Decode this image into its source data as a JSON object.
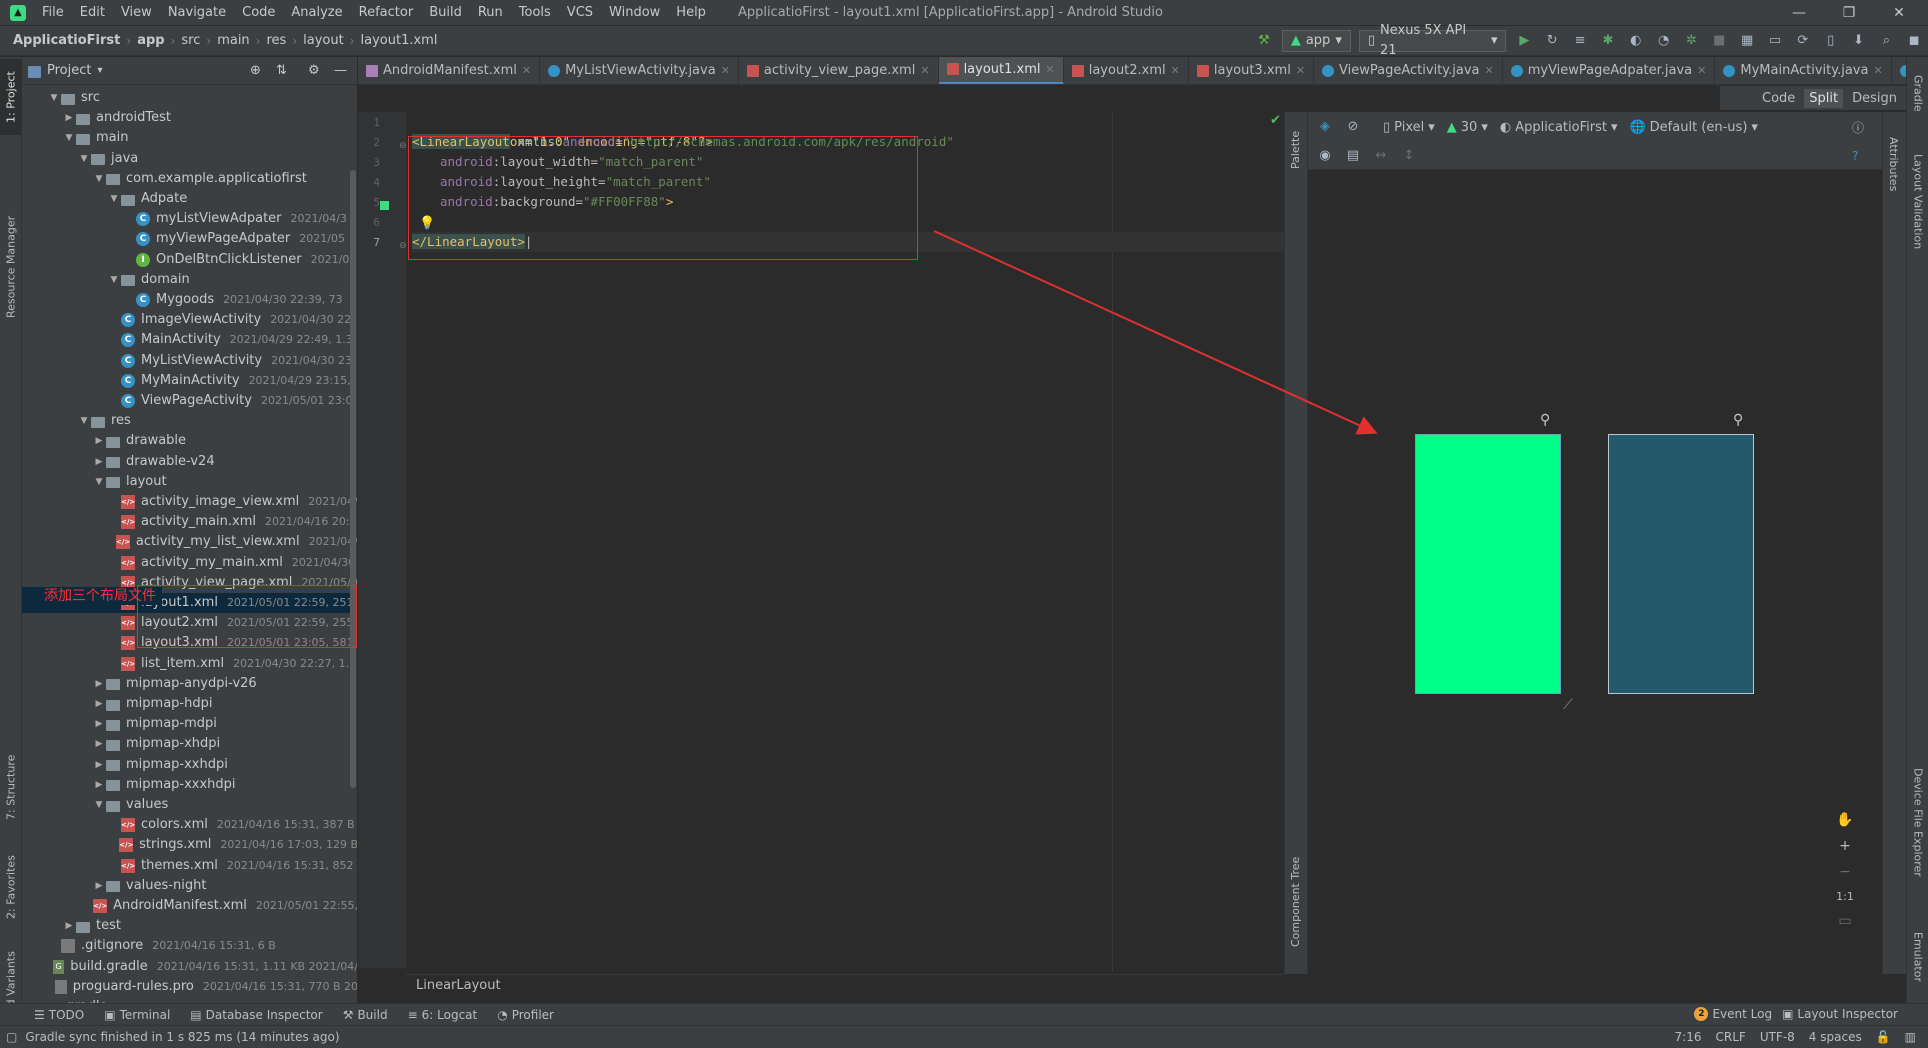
{
  "menubar": {
    "items": [
      "File",
      "Edit",
      "View",
      "Navigate",
      "Code",
      "Analyze",
      "Refactor",
      "Build",
      "Run",
      "Tools",
      "VCS",
      "Window",
      "Help"
    ],
    "window_title": "ApplicatioFirst - layout1.xml [ApplicatioFirst.app] - Android Studio"
  },
  "navbar": {
    "crumbs": [
      "ApplicatioFirst",
      "app",
      "src",
      "main",
      "res",
      "layout",
      "layout1.xml"
    ],
    "run_config": "app",
    "device": "Nexus 5X API 21"
  },
  "left_strip": {
    "tabs": [
      "1: Project",
      "Resource Manager",
      "7: Structure",
      "2: Favorites",
      "Build Variants"
    ]
  },
  "right_strip": {
    "tabs": [
      "Gradle",
      "Layout Validation",
      "Attributes",
      "Device File Explorer",
      "Emulator"
    ]
  },
  "project": {
    "header": "Project",
    "tree": [
      {
        "label": "src",
        "meta": "",
        "type": "folder",
        "indent": 1,
        "arrow": "down"
      },
      {
        "label": "androidTest",
        "meta": "",
        "type": "folder",
        "indent": 2,
        "arrow": "right"
      },
      {
        "label": "main",
        "meta": "",
        "type": "folder",
        "indent": 2,
        "arrow": "down"
      },
      {
        "label": "java",
        "meta": "",
        "type": "folder",
        "indent": 3,
        "arrow": "down"
      },
      {
        "label": "com.example.applicatiofirst",
        "meta": "",
        "type": "folder",
        "indent": 4,
        "arrow": "down"
      },
      {
        "label": "Adpate",
        "meta": "",
        "type": "folder",
        "indent": 5,
        "arrow": "down"
      },
      {
        "label": "myListViewAdpater",
        "meta": "2021/04/3",
        "type": "class",
        "indent": 6,
        "arrow": ""
      },
      {
        "label": "myViewPageAdpater",
        "meta": "2021/05",
        "type": "class",
        "indent": 6,
        "arrow": ""
      },
      {
        "label": "OnDelBtnClickListener",
        "meta": "2021/0",
        "type": "interface",
        "indent": 6,
        "arrow": ""
      },
      {
        "label": "domain",
        "meta": "",
        "type": "folder",
        "indent": 5,
        "arrow": "down"
      },
      {
        "label": "Mygoods",
        "meta": "2021/04/30 22:39, 73",
        "type": "class",
        "indent": 6,
        "arrow": ""
      },
      {
        "label": "ImageViewActivity",
        "meta": "2021/04/30 22",
        "type": "class",
        "indent": 5,
        "arrow": ""
      },
      {
        "label": "MainActivity",
        "meta": "2021/04/29 22:49, 1.3",
        "type": "class",
        "indent": 5,
        "arrow": ""
      },
      {
        "label": "MyListViewActivity",
        "meta": "2021/04/30 23",
        "type": "class",
        "indent": 5,
        "arrow": ""
      },
      {
        "label": "MyMainActivity",
        "meta": "2021/04/29 23:15,",
        "type": "class",
        "indent": 5,
        "arrow": ""
      },
      {
        "label": "ViewPageActivity",
        "meta": "2021/05/01 23:0",
        "type": "class",
        "indent": 5,
        "arrow": ""
      },
      {
        "label": "res",
        "meta": "",
        "type": "folder",
        "indent": 3,
        "arrow": "down"
      },
      {
        "label": "drawable",
        "meta": "",
        "type": "folder",
        "indent": 4,
        "arrow": "right"
      },
      {
        "label": "drawable-v24",
        "meta": "",
        "type": "folder",
        "indent": 4,
        "arrow": "right"
      },
      {
        "label": "layout",
        "meta": "",
        "type": "folder",
        "indent": 4,
        "arrow": "down"
      },
      {
        "label": "activity_image_view.xml",
        "meta": "2021/04/",
        "type": "xml",
        "indent": 5,
        "arrow": ""
      },
      {
        "label": "activity_main.xml",
        "meta": "2021/04/16 20:2",
        "type": "xml",
        "indent": 5,
        "arrow": ""
      },
      {
        "label": "activity_my_list_view.xml",
        "meta": "2021/04/",
        "type": "xml",
        "indent": 5,
        "arrow": ""
      },
      {
        "label": "activity_my_main.xml",
        "meta": "2021/04/30",
        "type": "xml",
        "indent": 5,
        "arrow": ""
      },
      {
        "label": "activity_view_page.xml",
        "meta": "2021/05/0",
        "type": "xml",
        "indent": 5,
        "arrow": ""
      },
      {
        "label": "layout1.xml",
        "meta": "2021/05/01 22:59, 251",
        "type": "xml",
        "indent": 5,
        "arrow": "",
        "selected": true
      },
      {
        "label": "layout2.xml",
        "meta": "2021/05/01 22:59, 255",
        "type": "xml",
        "indent": 5,
        "arrow": ""
      },
      {
        "label": "layout3.xml",
        "meta": "2021/05/01 23:05, 581",
        "type": "xml",
        "indent": 5,
        "arrow": ""
      },
      {
        "label": "list_item.xml",
        "meta": "2021/04/30 22:27, 1.3",
        "type": "xml",
        "indent": 5,
        "arrow": ""
      },
      {
        "label": "mipmap-anydpi-v26",
        "meta": "",
        "type": "folder",
        "indent": 4,
        "arrow": "right"
      },
      {
        "label": "mipmap-hdpi",
        "meta": "",
        "type": "folder",
        "indent": 4,
        "arrow": "right"
      },
      {
        "label": "mipmap-mdpi",
        "meta": "",
        "type": "folder",
        "indent": 4,
        "arrow": "right"
      },
      {
        "label": "mipmap-xhdpi",
        "meta": "",
        "type": "folder",
        "indent": 4,
        "arrow": "right"
      },
      {
        "label": "mipmap-xxhdpi",
        "meta": "",
        "type": "folder",
        "indent": 4,
        "arrow": "right"
      },
      {
        "label": "mipmap-xxxhdpi",
        "meta": "",
        "type": "folder",
        "indent": 4,
        "arrow": "right"
      },
      {
        "label": "values",
        "meta": "",
        "type": "folder",
        "indent": 4,
        "arrow": "down"
      },
      {
        "label": "colors.xml",
        "meta": "2021/04/16 15:31, 387 B",
        "type": "xml",
        "indent": 5,
        "arrow": ""
      },
      {
        "label": "strings.xml",
        "meta": "2021/04/16 17:03, 129 B",
        "type": "xml",
        "indent": 5,
        "arrow": ""
      },
      {
        "label": "themes.xml",
        "meta": "2021/04/16 15:31, 852",
        "type": "xml",
        "indent": 5,
        "arrow": ""
      },
      {
        "label": "values-night",
        "meta": "",
        "type": "folder",
        "indent": 4,
        "arrow": "right"
      },
      {
        "label": "AndroidManifest.xml",
        "meta": "2021/05/01 22:55,",
        "type": "manifest",
        "indent": 4,
        "arrow": ""
      },
      {
        "label": "test",
        "meta": "",
        "type": "folder",
        "indent": 2,
        "arrow": "right"
      },
      {
        "label": ".gitignore",
        "meta": "2021/04/16 15:31, 6 B",
        "type": "file",
        "indent": 1,
        "arrow": ""
      },
      {
        "label": "build.gradle",
        "meta": "2021/04/16 15:31, 1.11 KB 2021/04/",
        "type": "gradle",
        "indent": 1,
        "arrow": ""
      },
      {
        "label": "proguard-rules.pro",
        "meta": "2021/04/16 15:31, 770 B 20",
        "type": "file",
        "indent": 1,
        "arrow": ""
      },
      {
        "label": "gradle",
        "meta": "",
        "type": "folder",
        "indent": 0,
        "arrow": "right"
      }
    ],
    "annotation": "添加三个布局文件"
  },
  "tabs": [
    {
      "label": "AndroidManifest.xml",
      "kind": "man"
    },
    {
      "label": "MyListViewActivity.java",
      "kind": "java"
    },
    {
      "label": "activity_view_page.xml",
      "kind": "xml"
    },
    {
      "label": "layout1.xml",
      "kind": "xml",
      "active": true
    },
    {
      "label": "layout2.xml",
      "kind": "xml"
    },
    {
      "label": "layout3.xml",
      "kind": "xml"
    },
    {
      "label": "ViewPageActivity.java",
      "kind": "java"
    },
    {
      "label": "myViewPageAdpater.java",
      "kind": "java"
    },
    {
      "label": "MyMainActivity.java",
      "kind": "java"
    },
    {
      "label": "MainActivity.ja",
      "kind": "java"
    }
  ],
  "view_modes": {
    "code": "Code",
    "split": "Split",
    "design": "Design"
  },
  "code": {
    "line_numbers": [
      "1",
      "2",
      "3",
      "4",
      "5",
      "6",
      "7"
    ],
    "xml_decl": "<?xml version=\"1.0\" encoding=\"utf-8\"?>",
    "open_tag": "<LinearLayout",
    "ns_attr": " xmlns:",
    "ns_name": "android",
    "ns_eq": "=",
    "ns_val": "\"http://schemas.android.com/apk/res/android\"",
    "attr1_ns": "android",
    "attr1_name": ":layout_width",
    "attr1_val": "\"match_parent\"",
    "attr2_ns": "android",
    "attr2_name": ":layout_height",
    "attr2_val": "\"match_parent\"",
    "attr3_ns": "android",
    "attr3_name": ":background",
    "attr3_val": "\"#FF00FF88\"",
    "attr3_end": ">",
    "close_tag": "</LinearLayout>"
  },
  "editor_breadcrumb": "LinearLayout",
  "design_toolbar": {
    "device": "Pixel",
    "api": "30",
    "theme": "ApplicatioFirst",
    "locale": "Default (en-us)",
    "palette": "Palette",
    "component_tree": "Component Tree"
  },
  "preview_colors": {
    "design": "#00FF88",
    "blueprint": "#23596B"
  },
  "zoom": {
    "plus": "+",
    "minus": "−",
    "one_to_one": "1:1"
  },
  "bottom_tabs": [
    "TODO",
    "Terminal",
    "Database Inspector",
    "Build",
    "6: Logcat",
    "Profiler"
  ],
  "bottom_right": {
    "event_count": "2",
    "event_log": "Event Log",
    "layout_inspector": "Layout Inspector"
  },
  "status": {
    "message": "Gradle sync finished in 1 s 825 ms (14 minutes ago)",
    "position": "7:16",
    "line_sep": "CRLF",
    "encoding": "UTF-8",
    "indent": "4 spaces"
  }
}
